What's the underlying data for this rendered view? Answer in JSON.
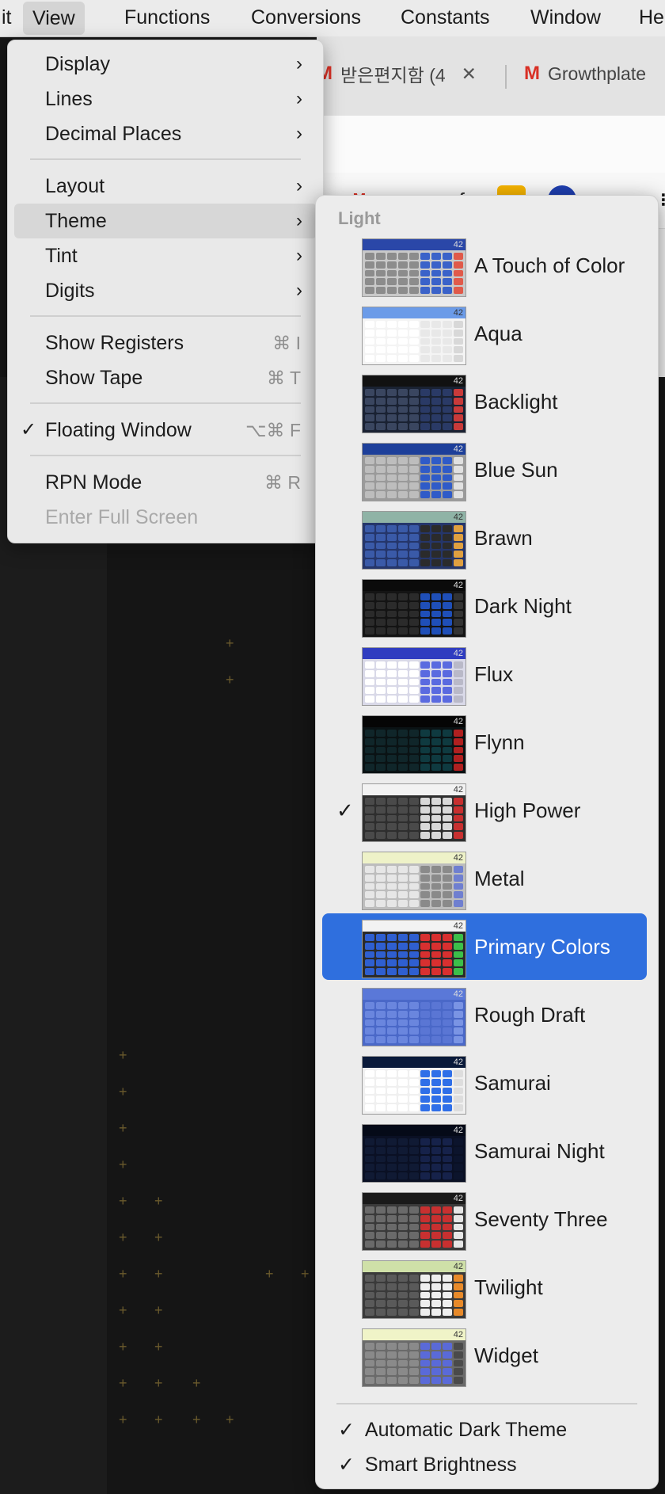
{
  "menubar": {
    "items": [
      "it",
      "View",
      "Functions",
      "Conversions",
      "Constants",
      "Window",
      "He"
    ]
  },
  "browser": {
    "tab1_label": "받은편지함 (4",
    "tab1_close": "✕",
    "tab2_label": "Growthplate",
    "gmail_glyph": "M"
  },
  "view_menu": {
    "display": "Display",
    "lines": "Lines",
    "decimal_places": "Decimal Places",
    "layout": "Layout",
    "theme": "Theme",
    "tint": "Tint",
    "digits": "Digits",
    "show_registers": "Show Registers",
    "show_registers_shortcut": "⌘ I",
    "show_tape": "Show Tape",
    "show_tape_shortcut": "⌘ T",
    "floating_window": "Floating Window",
    "floating_window_shortcut": "⌥⌘ F",
    "rpn_mode": "RPN Mode",
    "rpn_mode_shortcut": "⌘ R",
    "enter_full_screen": "Enter Full Screen",
    "chevron": "›",
    "check": "✓"
  },
  "theme_menu": {
    "section_header": "Light",
    "display_value": "42",
    "themes": [
      {
        "name": "A Touch of Color",
        "checked": false,
        "selected": false,
        "top": "#2a47a8",
        "body": "#c9c9c9",
        "key": "#8c8c8c",
        "accent": "#3a62c9",
        "alt": "#e05a4a"
      },
      {
        "name": "Aqua",
        "checked": false,
        "selected": false,
        "top": "#6b9be8",
        "body": "#f4f4f4",
        "key": "#ffffff",
        "accent": "#e8e8e8",
        "alt": "#d8d8d8"
      },
      {
        "name": "Backlight",
        "checked": false,
        "selected": false,
        "top": "#111111",
        "body": "#1a2233",
        "key": "#3a4660",
        "accent": "#2a3a66",
        "alt": "#c83a3a"
      },
      {
        "name": "Blue Sun",
        "checked": false,
        "selected": false,
        "top": "#1d3f9a",
        "body": "#9a9a9a",
        "key": "#bdbdbd",
        "accent": "#2f5bc8",
        "alt": "#e0e0e0"
      },
      {
        "name": "Brawn",
        "checked": false,
        "selected": false,
        "top": "#8fb3a6",
        "body": "#25366b",
        "key": "#3a5aa8",
        "accent": "#2b2b2b",
        "alt": "#e0a040"
      },
      {
        "name": "Dark Night",
        "checked": false,
        "selected": false,
        "top": "#0b0b0b",
        "body": "#141414",
        "key": "#2b2b2b",
        "accent": "#1f4fb8",
        "alt": "#333333"
      },
      {
        "name": "Flux",
        "checked": false,
        "selected": false,
        "top": "#2f3cc0",
        "body": "#d9d9e8",
        "key": "#ffffff",
        "accent": "#5a6ae0",
        "alt": "#b9b9c8"
      },
      {
        "name": "Flynn",
        "checked": false,
        "selected": false,
        "top": "#050505",
        "body": "#0a1214",
        "key": "#10262a",
        "accent": "#0f3a40",
        "alt": "#b02020"
      },
      {
        "name": "High Power",
        "checked": true,
        "selected": false,
        "top": "#f2f2f2",
        "body": "#2e2e2e",
        "key": "#4a4a4a",
        "accent": "#d8d8d8",
        "alt": "#c83030"
      },
      {
        "name": "Metal",
        "checked": false,
        "selected": false,
        "top": "#eef2c8",
        "body": "#bdbdbd",
        "key": "#e6e6e6",
        "accent": "#8a8a8a",
        "alt": "#6f7fd0"
      },
      {
        "name": "Primary Colors",
        "checked": false,
        "selected": true,
        "top": "#f2f2f2",
        "body": "#2a2a2a",
        "key": "#2f5fd0",
        "accent": "#d83030",
        "alt": "#3cbf4a"
      },
      {
        "name": "Rough Draft",
        "checked": false,
        "selected": false,
        "top": "#5a78d8",
        "body": "#4a68c8",
        "key": "#6a86de",
        "accent": "#5a76d4",
        "alt": "#7a94e4"
      },
      {
        "name": "Samurai",
        "checked": false,
        "selected": false,
        "top": "#0a1a3a",
        "body": "#f0f0f0",
        "key": "#ffffff",
        "accent": "#2f6fe8",
        "alt": "#dddddd"
      },
      {
        "name": "Samurai Night",
        "checked": false,
        "selected": false,
        "top": "#050a18",
        "body": "#0a1024",
        "key": "#101a34",
        "accent": "#16224a",
        "alt": "#0c142c"
      },
      {
        "name": "Seventy Three",
        "checked": false,
        "selected": false,
        "top": "#1a1a1a",
        "body": "#3a3a3a",
        "key": "#6a6a6a",
        "accent": "#c83030",
        "alt": "#e6e6e6"
      },
      {
        "name": "Twilight",
        "checked": false,
        "selected": false,
        "top": "#cfe0a8",
        "body": "#3a3a3a",
        "key": "#5a5a5a",
        "accent": "#eeeeee",
        "alt": "#e88a2a"
      },
      {
        "name": "Widget",
        "checked": false,
        "selected": false,
        "top": "#f0f4c8",
        "body": "#6a6a6a",
        "key": "#8a8a8a",
        "accent": "#5a6ad8",
        "alt": "#4a4a4a"
      }
    ],
    "automatic_dark_theme": "Automatic Dark Theme",
    "smart_brightness": "Smart Brightness",
    "check": "✓"
  },
  "colors": {
    "selection": "#2f6fde",
    "menu_bg": "#e9e9e9"
  }
}
